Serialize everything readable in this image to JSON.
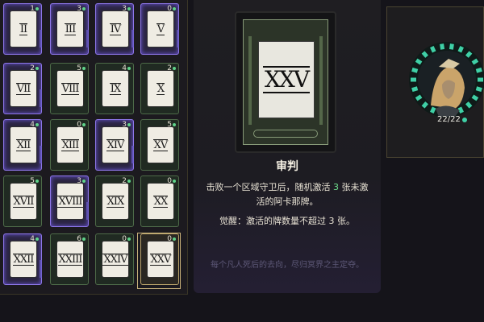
{
  "grid": {
    "cards": [
      {
        "numeral": "II",
        "cost": "1",
        "style": "purple"
      },
      {
        "numeral": "III",
        "cost": "3",
        "style": "purple"
      },
      {
        "numeral": "IV",
        "cost": "3",
        "style": "purple"
      },
      {
        "numeral": "V",
        "cost": "0",
        "style": "purple"
      },
      {
        "numeral": "VII",
        "cost": "2",
        "style": "purple"
      },
      {
        "numeral": "VIII",
        "cost": "5",
        "style": "green"
      },
      {
        "numeral": "IX",
        "cost": "4",
        "style": "green"
      },
      {
        "numeral": "X",
        "cost": "2",
        "style": "green"
      },
      {
        "numeral": "XII",
        "cost": "4",
        "style": "purple"
      },
      {
        "numeral": "XIII",
        "cost": "0",
        "style": "green"
      },
      {
        "numeral": "XIV",
        "cost": "3",
        "style": "purple"
      },
      {
        "numeral": "XV",
        "cost": "5",
        "style": "green"
      },
      {
        "numeral": "XVII",
        "cost": "5",
        "style": "green"
      },
      {
        "numeral": "XVIII",
        "cost": "3",
        "style": "purple"
      },
      {
        "numeral": "XIX",
        "cost": "2",
        "style": "green"
      },
      {
        "numeral": "XX",
        "cost": "0",
        "style": "green"
      },
      {
        "numeral": "XXII",
        "cost": "4",
        "style": "purple"
      },
      {
        "numeral": "XXIII",
        "cost": "6",
        "style": "green"
      },
      {
        "numeral": "XXIV",
        "cost": "0",
        "style": "green"
      },
      {
        "numeral": "XXV",
        "cost": "0",
        "style": "gold"
      }
    ]
  },
  "detail": {
    "card_numeral": "XXV",
    "title": "审判",
    "desc_part1": "击败一个区域守卫后，随机激活",
    "desc_highlight": "3",
    "desc_part2": "张未激活的阿卡那牌。",
    "awaken": "觉醒：激活的牌数量不超过 3 张。",
    "flavor": "每个凡人死后的去向，尽归冥界之主定夺。"
  },
  "portrait": {
    "hp": "22/22"
  },
  "colors": {
    "accent_green": "#6fe08e",
    "ring_teal": "#3fd0a6",
    "purple_border": "#8d76e8",
    "gold_border": "#c9b27a"
  }
}
